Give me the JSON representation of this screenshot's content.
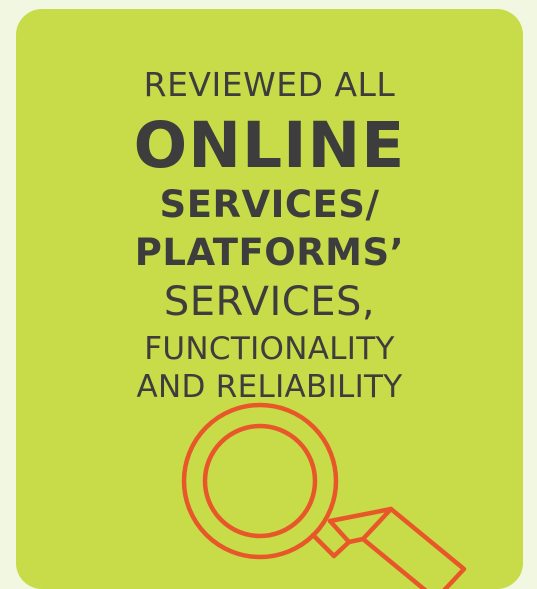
{
  "headline": {
    "line1": "REVIEWED ALL",
    "line2": "ONLINE",
    "line3": "SERVICES/",
    "line4": "PLATFORMS’",
    "line5": "SERVICES,",
    "line6": "FUNCTIONALITY",
    "line7": "AND RELIABILITY"
  },
  "colors": {
    "background": "#f2f7e1",
    "card": "#c7dc48",
    "text": "#3d3d3d",
    "icon_stroke": "#e8572a"
  },
  "icon": "magnifying-glass-icon"
}
